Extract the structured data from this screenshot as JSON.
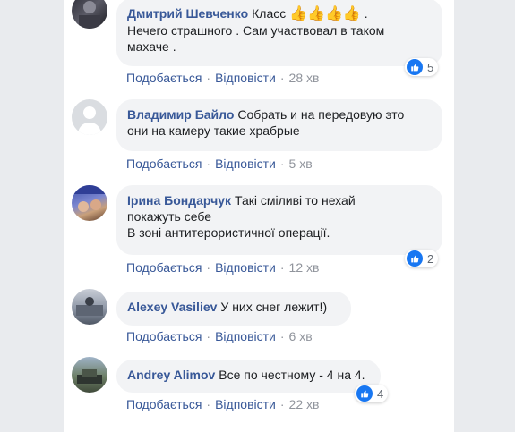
{
  "comments": [
    {
      "author": "Дмитрий Шевченко",
      "text_line1": "Класс",
      "emojis": "👍👍👍👍",
      "text_line1_end": ".",
      "text_line2": "Нечего страшного . Сам участвовал в таком",
      "text_line3": "махаче .",
      "like_label": "Подобається",
      "reply_label": "Відповісти",
      "time": "28 хв",
      "reaction_count": "5"
    },
    {
      "author": "Владимир Байло",
      "text_line1": "Собрать и на передовую это",
      "text_line2": "они на камеру такие храбрые",
      "like_label": "Подобається",
      "reply_label": "Відповісти",
      "time": "5 хв"
    },
    {
      "author": "Ірина Бондарчук",
      "text_line1": "Такі сміливі то нехай",
      "text_line2": "покажуть себе",
      "text_line3": "В зоні антитерористичної операції.",
      "like_label": "Подобається",
      "reply_label": "Відповісти",
      "time": "12 хв",
      "reaction_count": "2"
    },
    {
      "author": "Alexey Vasiliev",
      "text_line1": "У них снег лежит!)",
      "like_label": "Подобається",
      "reply_label": "Відповісти",
      "time": "6 хв"
    },
    {
      "author": "Andrey Alimov",
      "text_line1": "Все по честному - 4 на 4.",
      "like_label": "Подобається",
      "reply_label": "Відповісти",
      "time": "22 хв",
      "reaction_count": "4"
    }
  ],
  "icons": {
    "like": "thumbs-up-icon"
  },
  "colors": {
    "author": "#385898",
    "bubble": "#f2f3f5",
    "like_badge": "#1877f2"
  }
}
